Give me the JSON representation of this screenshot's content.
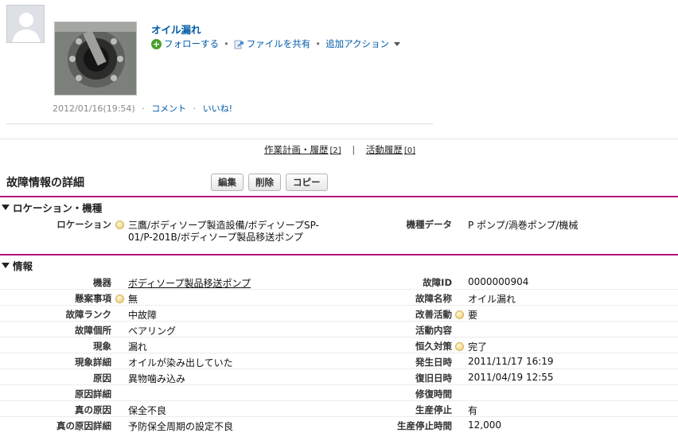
{
  "feed": {
    "title": "オイル漏れ",
    "actions": {
      "follow": "フォローする",
      "share_file": "ファイルを共有",
      "more_actions": "追加アクション"
    },
    "timestamp": "2012/01/16(19:54)",
    "comment": "コメント",
    "like": "いいね!"
  },
  "related": {
    "work_plan": "作業計画・履歴",
    "work_plan_count": "[2]",
    "activity": "活動履歴",
    "activity_count": "[0]"
  },
  "detail": {
    "title": "故障情報の詳細",
    "buttons": {
      "edit": "編集",
      "delete": "削除",
      "copy": "コピー"
    }
  },
  "section_location": {
    "heading": "ロケーション・機種",
    "location_label": "ロケーション",
    "location_value_line1": "三鷹/ボディソープ製造設備/ボディソープSP-",
    "location_value_line2": "01/P-201B/ボディソープ製品移送ポンプ",
    "model_label": "機種データ",
    "model_value": "P ポンプ/渦巻ポンプ/機械"
  },
  "section_info": {
    "heading": "情報",
    "rows": [
      {
        "left_label": "機器",
        "left_value": "ボディソープ製品移送ポンプ",
        "right_label": "故障ID",
        "right_value": "0000000904"
      },
      {
        "left_label": "懸案事項",
        "left_value": "無",
        "right_label": "故障名称",
        "right_value": "オイル漏れ"
      },
      {
        "left_label": "故障ランク",
        "left_value": "中故障",
        "right_label": "改善活動",
        "right_value": "要"
      },
      {
        "left_label": "故障個所",
        "left_value": "ベアリング",
        "right_label": "活動内容",
        "right_value": ""
      },
      {
        "left_label": "現象",
        "left_value": "漏れ",
        "right_label": "恒久対策",
        "right_value": "完了"
      },
      {
        "left_label": "現象詳細",
        "left_value": "オイルが染み出していた",
        "right_label": "発生日時",
        "right_value": "2011/11/17 16:19"
      },
      {
        "left_label": "原因",
        "left_value": "異物噛み込み",
        "right_label": "復旧日時",
        "right_value": "2011/04/19 12:55"
      },
      {
        "left_label": "原因詳細",
        "left_value": "",
        "right_label": "修復時間",
        "right_value": ""
      },
      {
        "left_label": "真の原因",
        "left_value": "保全不良",
        "right_label": "生産停止",
        "right_value": "有"
      },
      {
        "left_label": "真の原因詳細",
        "left_value": "予防保全周期の設定不良",
        "right_label": "生産停止時間",
        "right_value": "12,000"
      }
    ]
  },
  "colors": {
    "link": "#015ba7",
    "section_rule": "#b3137e",
    "follow_icon": "#4aa02c"
  }
}
